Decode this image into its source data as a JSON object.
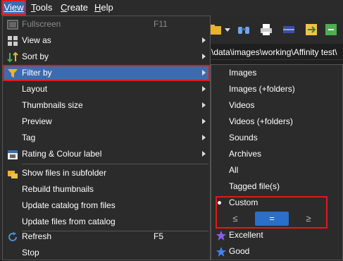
{
  "menubar": {
    "view": "View",
    "tools_first": "T",
    "tools_rest": "ools",
    "create_first": "C",
    "create_rest": "reate",
    "help_first": "H",
    "help_rest": "elp"
  },
  "path_text": "\\data\\images\\working\\Affinity test\\",
  "menu": {
    "fullscreen": "Fullscreen",
    "fullscreen_shortcut": "F11",
    "view_as": "View as",
    "sort_by": "Sort by",
    "filter_by": "Filter by",
    "layout": "Layout",
    "thumbnails_size": "Thumbnails size",
    "preview": "Preview",
    "tag": "Tag",
    "rating_colour": "Rating & Colour label",
    "show_subfolder": "Show files in subfolder",
    "rebuild_thumbs": "Rebuild thumbnails",
    "update_catalog": "Update catalog from files",
    "update_files": "Update files from catalog",
    "refresh": "Refresh",
    "refresh_shortcut": "F5",
    "stop": "Stop"
  },
  "submenu": {
    "images": "Images",
    "images_folders": "Images (+folders)",
    "videos": "Videos",
    "videos_folders": "Videos (+folders)",
    "sounds": "Sounds",
    "archives": "Archives",
    "all": "All",
    "tagged": "Tagged file(s)",
    "custom": "Custom",
    "cmp_le": "≤",
    "cmp_eq": "=",
    "cmp_ge": "≥",
    "excellent": "Excellent",
    "good": "Good"
  },
  "colors": {
    "highlight": "#3a6db0",
    "annotation_border": "#e0191b",
    "menu_bg": "#2b2b2b"
  }
}
